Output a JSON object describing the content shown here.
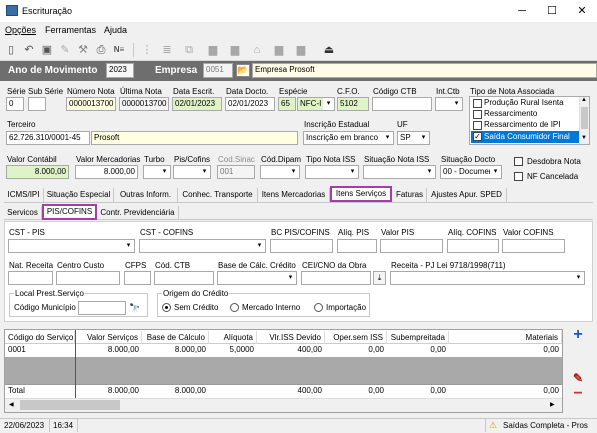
{
  "window": {
    "title": "Escrituração",
    "minimize": "─",
    "maximize": "☐",
    "close": "✕"
  },
  "menu": [
    "Opções",
    "Ferramentas",
    "Ajuda"
  ],
  "header": {
    "ano_label": "Ano de Movimento",
    "ano_value": "2023",
    "empresa_label": "Empresa",
    "empresa_code": "0051",
    "empresa_name": "Empresa Prosoft"
  },
  "row1": {
    "serie_label": "Série",
    "serie": "0",
    "subserie_label": "Sub Série",
    "numero_label": "Número Nota",
    "numero": "0000013700",
    "ultima_label": "Última Nota",
    "ultima": "0000013700",
    "data_escrit_label": "Data Escrit.",
    "data_escrit": "02/01/2023",
    "data_docto_label": "Data Docto.",
    "data_docto": "02/01/2023",
    "especie_label": "Espécie",
    "especie": "65",
    "especie_desc": "NFC-I",
    "cfo_label": "C.F.O.",
    "cfo": "5102",
    "codigo_ctb_label": "Código CTB",
    "int_ctb_label": "Int.Ctb"
  },
  "tipo_nota": {
    "label": "Tipo de Nota Associada",
    "items": [
      {
        "label": "Produção Rural Isenta",
        "checked": false
      },
      {
        "label": "Ressarcimento",
        "checked": false
      },
      {
        "label": "Ressarcimento de IPI",
        "checked": false
      },
      {
        "label": "Saída Consumidor Final",
        "checked": true
      }
    ]
  },
  "row2": {
    "terceiro_label": "Terceiro",
    "terceiro_cnpj": "62.726.310/0001-45",
    "terceiro_nome": "Prosoft",
    "inscricao_label": "Inscrição Estadual",
    "inscricao": "Inscrição em branco",
    "uf_label": "UF",
    "uf": "SP"
  },
  "row3": {
    "valor_contabil_label": "Valor Contábil",
    "valor_contabil": "8.000,00",
    "valor_merc_label": "Valor Mercadorias",
    "valor_merc": "8.000,00",
    "turbo_label": "Turbo",
    "pis_cofins_label": "Pis/Cofins",
    "cod_sinac_label": "Cod.Sinac",
    "cod_sinac": "001",
    "cod_dipam_label": "Cód.Dipam",
    "tipo_iss_label": "Tipo Nota ISS",
    "situacao_iss_label": "Situação Nota ISS",
    "situacao_docto_label": "Situação Docto",
    "situacao_docto": "00 - Documen",
    "desdobra_label": "Desdobra Nota",
    "nf_cancelada_label": "NF Cancelada"
  },
  "tabs": [
    "ICMS/IPI",
    "Situação Especial",
    "Outras Inform.",
    "Conhec. Transporte",
    "Itens Mercadorias",
    "Itens Serviços",
    "Faturas",
    "Ajustes Apur. SPED"
  ],
  "subtabs": [
    "Servicos",
    "PIS/COFINS",
    "Contr. Previdenciária"
  ],
  "pis": {
    "cst_pis_label": "CST - PIS",
    "cst_cofins_label": "CST - COFINS",
    "bc_label": "BC PIS/COFINS",
    "aliq_pis_label": "Alíq. PIS",
    "valor_pis_label": "Valor PIS",
    "aliq_cofins_label": "Alíq. COFINS",
    "valor_cofins_label": "Valor COFINS",
    "nat_receita_label": "Nat. Receita",
    "centro_custo_label": "Centro Custo",
    "cfps_label": "CFPS",
    "cod_ctb_label": "Cód. CTB",
    "base_credito_label": "Base de Cálc. Crédito",
    "cei_label": "CEI/CNO da Obra",
    "receita_label": "Receita - PJ Lei 9718/1998(711)"
  },
  "local": {
    "label": "Local Prest.Serviço",
    "municipio_label": "Código Município"
  },
  "origem": {
    "label": "Origem do Crédito",
    "options": [
      "Sem Crédito",
      "Mercado Interno",
      "Importação"
    ],
    "selected": "Sem Crédito"
  },
  "grid": {
    "headers": [
      "Código do Serviço",
      "Valor Serviços",
      "Base de Cálculo",
      "Alíquota",
      "Vlr.ISS Devido",
      "Oper.sem ISS",
      "Subempreitada",
      "Materiais"
    ],
    "rows": [
      [
        "0001",
        "8.000,00",
        "8.000,00",
        "5,0000",
        "400,00",
        "0,00",
        "0,00",
        "0,00"
      ]
    ],
    "total": [
      "Total",
      "8.000,00",
      "8.000,00",
      "",
      "400,00",
      "0,00",
      "0,00",
      "0,00"
    ]
  },
  "status": {
    "date": "22/06/2023",
    "time": "16:34",
    "message": "Saídas Completa - Pros"
  },
  "colors": {
    "dark_header": "#6e6e6e",
    "highlight": "#a23ea8",
    "selected": "#0078d7",
    "green": "#dff3c9",
    "yellow": "#ffffe1"
  }
}
